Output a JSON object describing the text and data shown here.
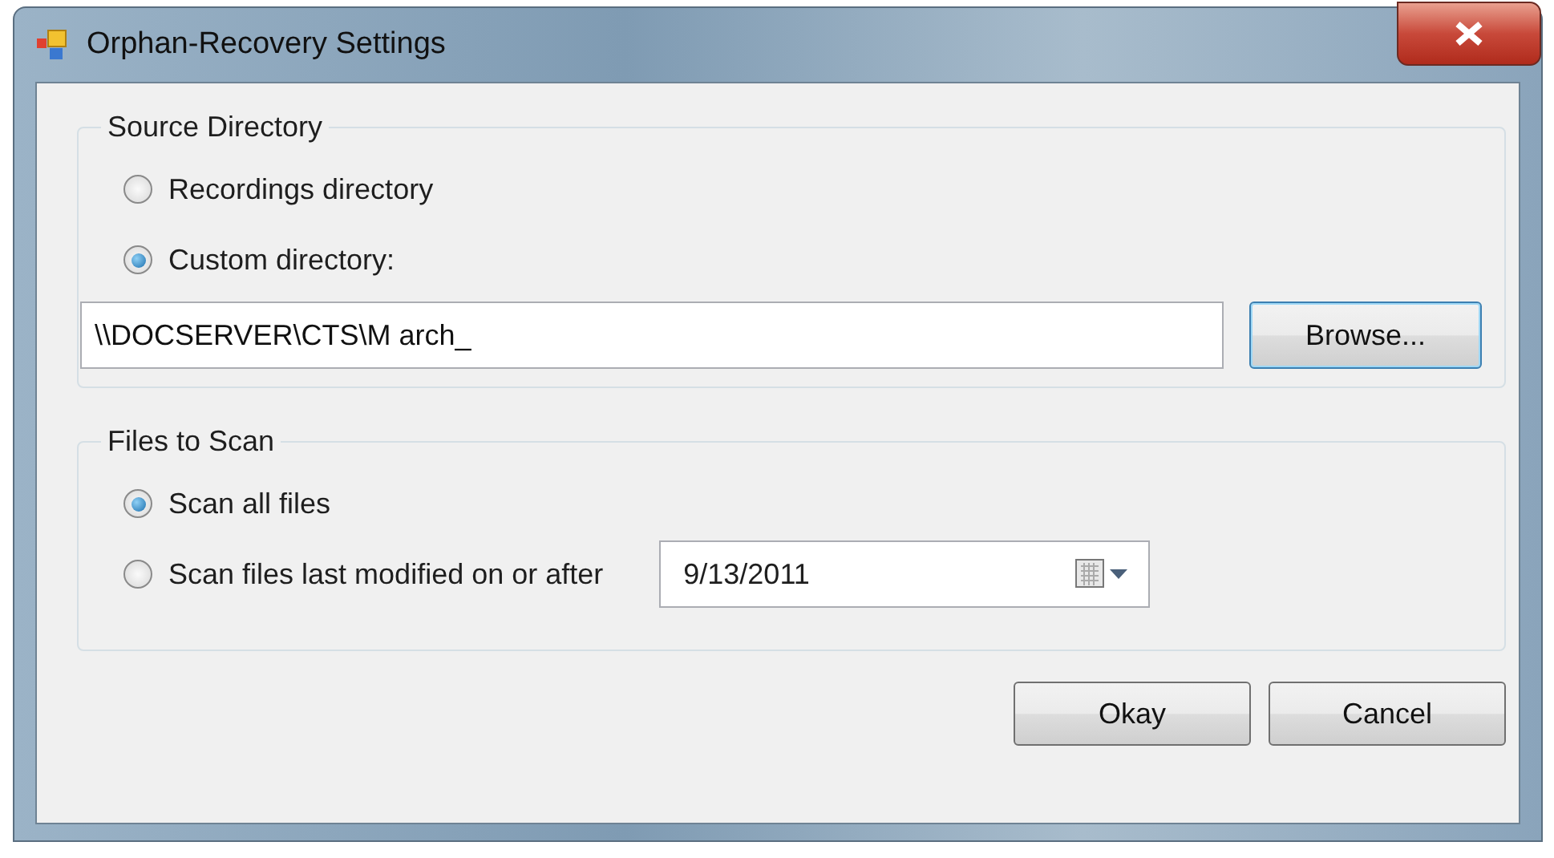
{
  "window": {
    "title": "Orphan-Recovery Settings"
  },
  "source_directory": {
    "title": "Source Directory",
    "options": [
      {
        "label": "Recordings directory",
        "selected": false
      },
      {
        "label": "Custom directory:",
        "selected": true
      }
    ],
    "path": {
      "value": "\\\\DOCSERVER\\CTS\\M arch_"
    },
    "browse_button": "Browse..."
  },
  "files_to_scan": {
    "title": "Files to Scan",
    "options": [
      {
        "label": "Scan all files",
        "selected": true
      },
      {
        "label": "Scan files last modified on or after",
        "selected": false
      }
    ],
    "date": {
      "value": "9/13/2011"
    }
  },
  "buttons": [
    "Okay",
    "Cancel"
  ]
}
